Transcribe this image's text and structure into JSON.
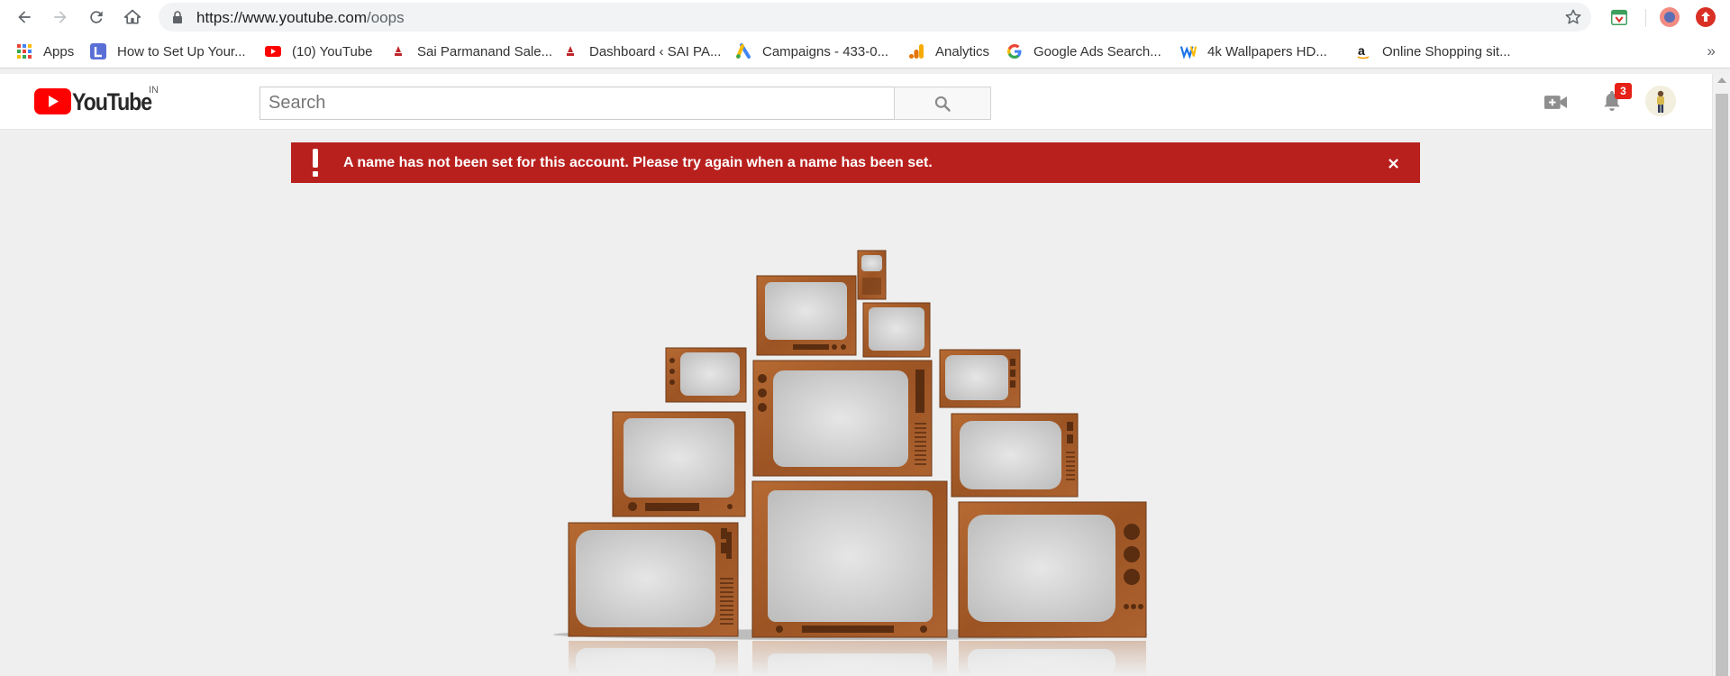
{
  "browser": {
    "url_host": "https://www.youtube.com",
    "url_path": "/oops",
    "bookmarks": [
      {
        "label": "Apps",
        "icon": "apps-grid-icon"
      },
      {
        "label": "How to Set Up Your...",
        "icon": "l-app-icon"
      },
      {
        "label": "(10) YouTube",
        "icon": "youtube-favicon"
      },
      {
        "label": "Sai Parmanand Sale...",
        "icon": "sai-favicon"
      },
      {
        "label": "Dashboard ‹ SAI PA...",
        "icon": "sai-favicon"
      },
      {
        "label": "Campaigns - 433-0...",
        "icon": "google-ads-icon"
      },
      {
        "label": "Analytics",
        "icon": "analytics-icon"
      },
      {
        "label": "Google Ads Search...",
        "icon": "google-g-icon"
      },
      {
        "label": "4k Wallpapers HD...",
        "icon": "w-logo-icon"
      },
      {
        "label": "Online Shopping sit...",
        "icon": "amazon-icon"
      }
    ],
    "more_bookmarks": "»"
  },
  "youtube": {
    "logo_text": "YouTube",
    "region": "IN",
    "search_placeholder": "Search",
    "notification_count": "3"
  },
  "alert": {
    "message": "A name has not been set for this account. Please try again when a name has been set."
  },
  "colors": {
    "alert_bg": "#b8201e",
    "youtube_red": "#ff0000",
    "page_bg": "#efefef",
    "tv_wood": "#a65a28"
  }
}
